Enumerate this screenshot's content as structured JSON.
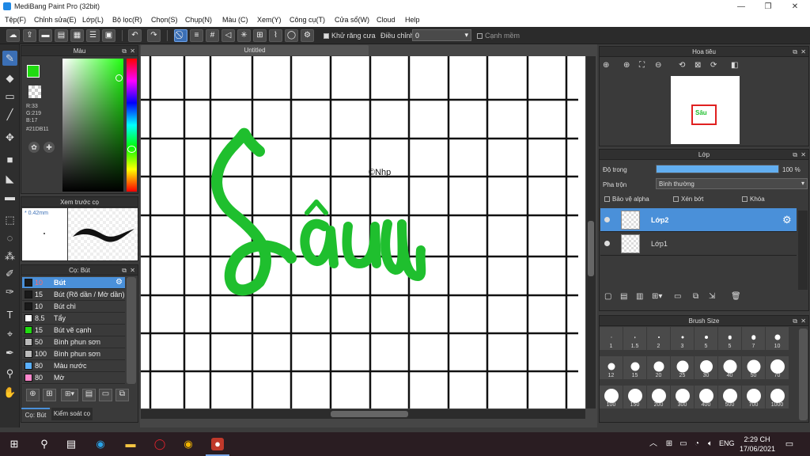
{
  "window": {
    "title": "MediBang Paint Pro (32bit)",
    "minimize": "—",
    "maximize": "❐",
    "close": "✕"
  },
  "menu": [
    "Tệp(F)",
    "Chỉnh sửa(E)",
    "Lớp(L)",
    "Bộ lọc(R)",
    "Chọn(S)",
    "Chụp(N)",
    "Màu (C)",
    "Xem(Y)",
    "Công cụ(T)",
    "Cửa sổ(W)",
    "Cloud",
    "Help"
  ],
  "toolbar": {
    "antialias_label": "Khử răng cưa",
    "adjust_label": "Điều chỉnh",
    "adjust_value": "0",
    "smooth_label": "Cạnh mềm"
  },
  "color_panel": {
    "title": "Màu",
    "r": "R:33",
    "g": "G:219",
    "b": "B:17",
    "hex": "#21DB11",
    "primary": "#21db11"
  },
  "brush_preview": {
    "title": "Xem trước cọ",
    "size": "* 0.42mm"
  },
  "brush_panel": {
    "title": "Cọ: Bút",
    "tab1": "Cọ: Bút",
    "tab2": "Kiểm soát cọ",
    "items": [
      {
        "size": "10",
        "name": "Bút",
        "color": "#1a1a1a"
      },
      {
        "size": "15",
        "name": "Bút (Rõ dần / Mờ dần)",
        "color": "#1a1a1a"
      },
      {
        "size": "10",
        "name": "Bút chì",
        "color": "#1a1a1a"
      },
      {
        "size": "8.5",
        "name": "Tẩy",
        "color": "#ffffff"
      },
      {
        "size": "15",
        "name": "Bút vẽ cạnh",
        "color": "#21db11"
      },
      {
        "size": "50",
        "name": "Bình phun sơn",
        "color": "#bbbbbb"
      },
      {
        "size": "100",
        "name": "Bình phun sơn",
        "color": "#bbbbbb"
      },
      {
        "size": "80",
        "name": "Màu nước",
        "color": "#5ab0ff"
      },
      {
        "size": "80",
        "name": "Mờ",
        "color": "#ff88cc"
      }
    ]
  },
  "document": {
    "tab": "Untitled",
    "lettering": "Sâu",
    "signature": "©Nhp"
  },
  "navigator": {
    "title": "Hoa tiêu"
  },
  "layers": {
    "title": "Lớp",
    "opacity_label": "Độ trong",
    "opacity_value": "100 %",
    "opacity_fraction": 1.0,
    "blend_label": "Pha trộn",
    "blend_value": "Bình thường",
    "protect_alpha": "Bảo vệ alpha",
    "clipping": "Xén bớt",
    "lock": "Khóa",
    "items": [
      {
        "name": "Lớp2",
        "selected": true
      },
      {
        "name": "Lớp1",
        "selected": false
      }
    ]
  },
  "brush_size": {
    "title": "Brush Size",
    "sizes": [
      "1",
      "1.5",
      "2",
      "3",
      "5",
      "5",
      "7",
      "10",
      "12",
      "15",
      "20",
      "25",
      "30",
      "40",
      "50",
      "70",
      "100",
      "150",
      "200",
      "300",
      "400",
      "500",
      "700",
      "1000"
    ]
  },
  "taskbar": {
    "time": "2:29 CH",
    "date": "17/06/2021",
    "lang": "ENG"
  }
}
